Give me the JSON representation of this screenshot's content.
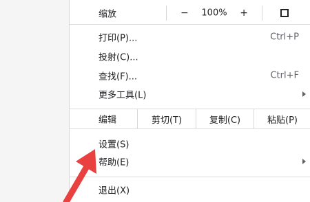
{
  "menu": {
    "zoom": {
      "label": "缩放",
      "minus": "−",
      "level": "100%",
      "plus": "+"
    },
    "items_group1": [
      {
        "label": "打印(P)...",
        "shortcut": "Ctrl+P"
      },
      {
        "label": "投射(C)...",
        "shortcut": ""
      },
      {
        "label": "查找(F)...",
        "shortcut": "Ctrl+F"
      },
      {
        "label": "更多工具(L)",
        "shortcut": ""
      }
    ],
    "edit": {
      "label": "编辑",
      "cut": "剪切(T)",
      "copy": "复制(C)",
      "paste": "粘贴(P)"
    },
    "settings": {
      "label": "设置(S)"
    },
    "help": {
      "label": "帮助(E)"
    },
    "exit": {
      "label": "退出(X)"
    }
  },
  "icons": {
    "fullscreen": "fullscreen-icon",
    "submenu_arrow": "chevron-right-icon",
    "annotation_arrow": "red-arrow"
  },
  "colors": {
    "annotation": "#e8413f",
    "text": "#202124",
    "separator": "#dcdcdc"
  }
}
